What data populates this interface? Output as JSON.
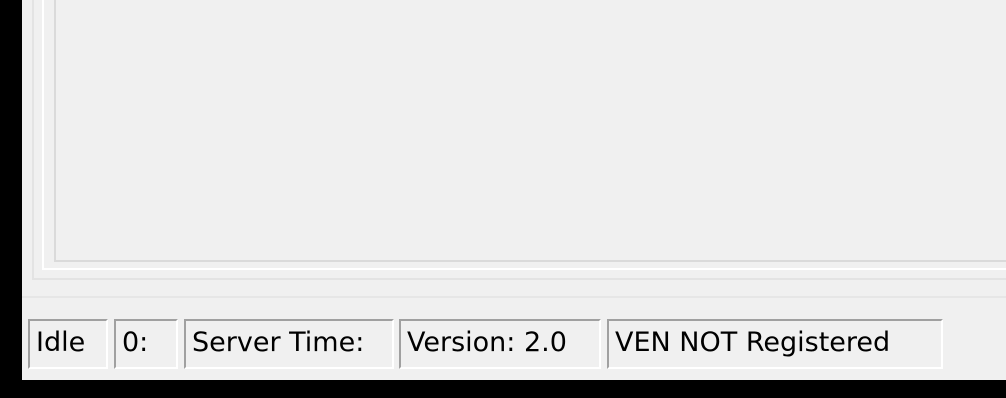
{
  "status_bar": {
    "state": "Idle",
    "count": "0:",
    "server_time": "Server Time:",
    "version": "Version: 2.0",
    "registration": "VEN NOT Registered"
  }
}
